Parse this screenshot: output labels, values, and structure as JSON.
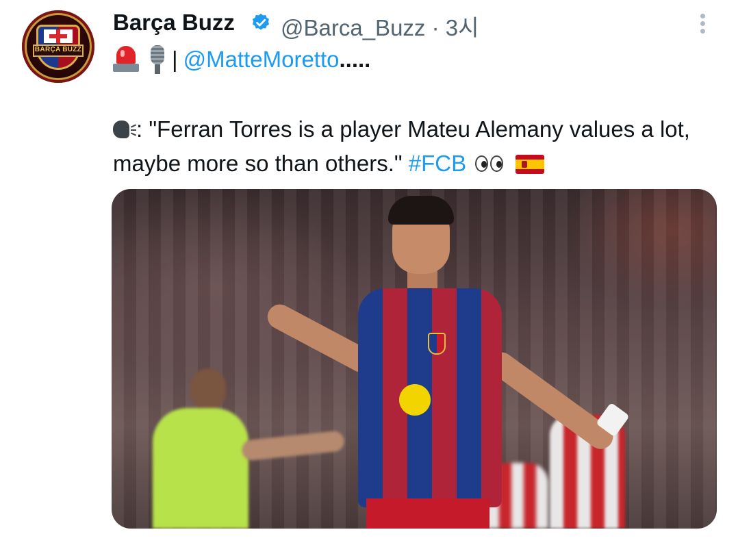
{
  "tweet": {
    "author_name": "Barça Buzz",
    "handle": "@Barca_Buzz",
    "time": "· 3시",
    "avatar_text": "BARÇA BUZZ",
    "mention": "@MatteMoretto",
    "mention_suffix": ".....",
    "pipe": "|",
    "speaker_suffix": ":",
    "quote": " \"Ferran Torres is a player Mateu Alemany values a lot, maybe more so than others.\" ",
    "hashtag": "#FCB",
    "icons": {
      "more": "more-vertical-icon",
      "verified": "verified-badge-icon",
      "siren": "rotating-light-emoji",
      "mic": "microphone-emoji",
      "speaking": "speaking-head-emoji",
      "eyes": "eyes-emoji",
      "flag": "spain-flag-emoji"
    }
  },
  "colors": {
    "link": "#1d9bf0",
    "secondary_text": "#536471",
    "primary_text": "#0f1419"
  }
}
